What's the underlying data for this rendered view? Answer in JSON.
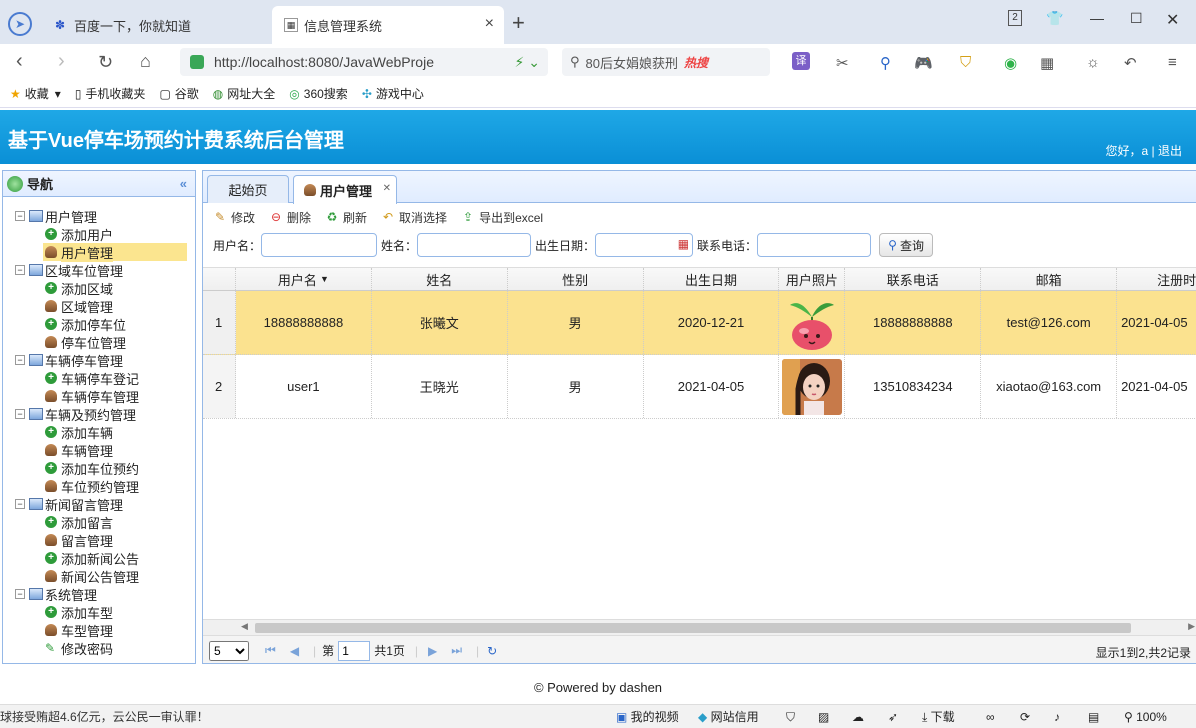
{
  "browser": {
    "tabs": [
      {
        "title": "百度一下，你就知道",
        "icon": "paw-icon"
      },
      {
        "title": "信息管理系统",
        "icon": "page-icon"
      }
    ],
    "url": "http://localhost:8080/JavaWebProje",
    "search_text": "80后女娟娘获刑",
    "hot_label": "热搜",
    "tab_count": "2",
    "bookmarks": [
      "收藏",
      "手机收藏夹",
      "谷歌",
      "网址大全",
      "360搜索",
      "游戏中心"
    ]
  },
  "app": {
    "title": "基于Vue停车场预约计费系统后台管理",
    "greeting": "您好，a",
    "logout": "退出"
  },
  "nav": {
    "title": "导航",
    "groups": [
      {
        "label": "用户管理",
        "items": [
          "添加用户",
          "用户管理"
        ]
      },
      {
        "label": "区域车位管理",
        "items": [
          "添加区域",
          "区域管理",
          "添加停车位",
          "停车位管理"
        ]
      },
      {
        "label": "车辆停车管理",
        "items": [
          "车辆停车登记",
          "车辆停车管理"
        ]
      },
      {
        "label": "车辆及预约管理",
        "items": [
          "添加车辆",
          "车辆管理",
          "添加车位预约",
          "车位预约管理"
        ]
      },
      {
        "label": "新闻留言管理",
        "items": [
          "添加留言",
          "留言管理",
          "添加新闻公告",
          "新闻公告管理"
        ]
      },
      {
        "label": "系统管理",
        "items": [
          "添加车型",
          "车型管理",
          "修改密码"
        ]
      }
    ]
  },
  "panel_tabs": {
    "start": "起始页",
    "current": "用户管理"
  },
  "toolbar": {
    "edit": "修改",
    "delete": "删除",
    "refresh": "刷新",
    "cancel_select": "取消选择",
    "export": "导出到excel"
  },
  "search": {
    "username_label": "用户名：",
    "name_label": "姓名：",
    "birth_label": "出生日期：",
    "phone_label": "联系电话：",
    "query": "查询"
  },
  "grid": {
    "columns": [
      "用户名",
      "姓名",
      "性别",
      "出生日期",
      "用户照片",
      "联系电话",
      "邮箱",
      "注册时"
    ],
    "rows": [
      {
        "no": "1",
        "username": "18888888888",
        "name": "张曦文",
        "gender": "男",
        "birth": "2020-12-21",
        "phone": "18888888888",
        "email": "test@126.com",
        "reg": "2021-04-05"
      },
      {
        "no": "2",
        "username": "user1",
        "name": "王晓光",
        "gender": "男",
        "birth": "2021-04-05",
        "phone": "13510834234",
        "email": "xiaotao@163.com",
        "reg": "2021-04-05"
      }
    ]
  },
  "pager": {
    "page_size": "5",
    "page_prefix": "第",
    "page_value": "1",
    "page_suffix": "共1页",
    "info": "显示1到2,共2记录"
  },
  "footer": "© Powered by dashen",
  "status": {
    "news": "球接受贿超4.6亿元，云公民一审认罪！",
    "video": "我的视频",
    "credit": "网站信用",
    "download": "下载",
    "zoom": "100%"
  }
}
